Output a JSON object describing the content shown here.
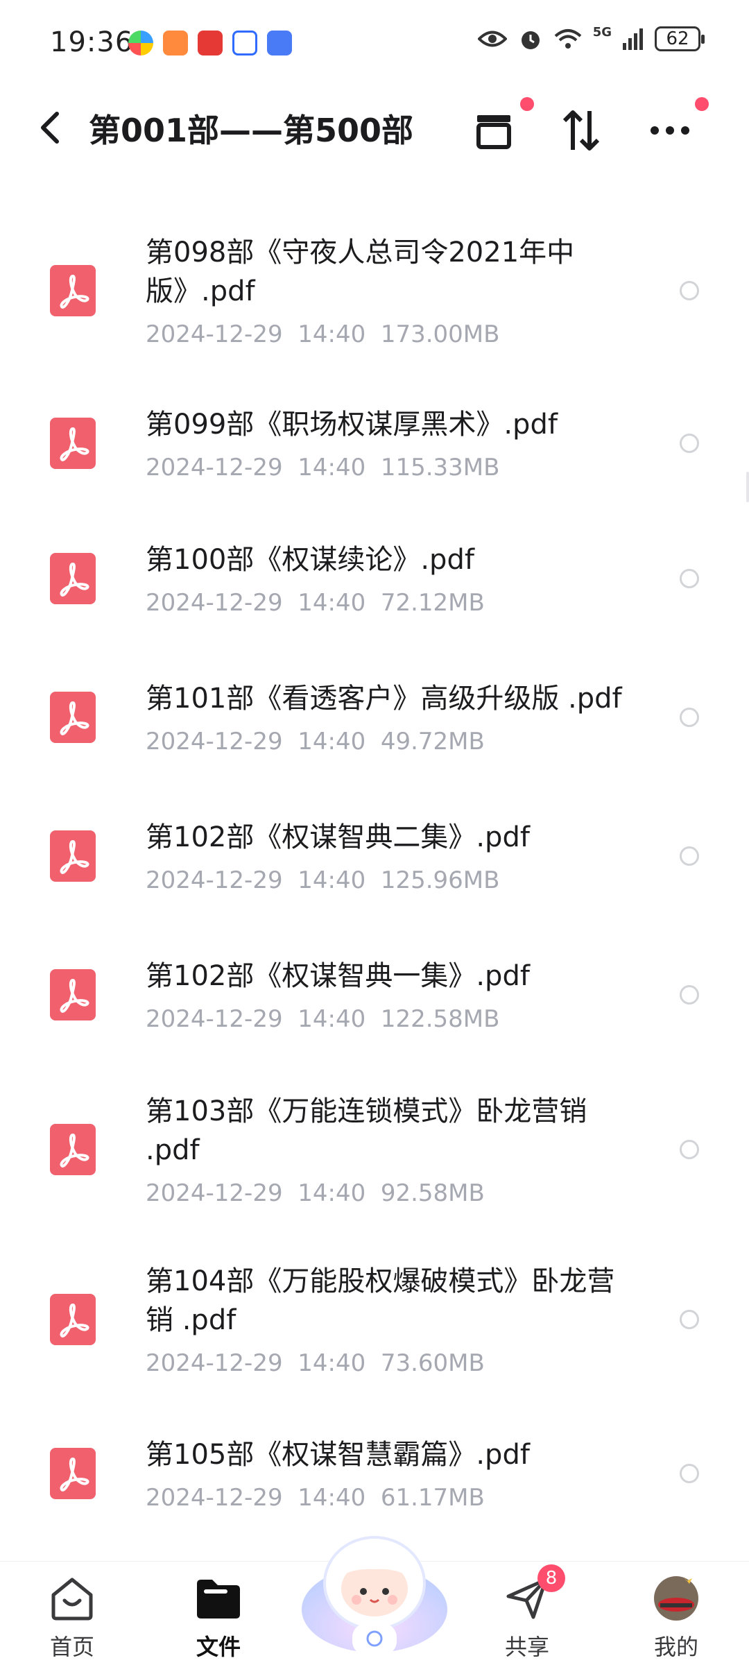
{
  "status": {
    "time": "19:36",
    "network": "5G",
    "battery": "62"
  },
  "header": {
    "title": "第001部——第500部"
  },
  "files": [
    {
      "name": "第098部《守夜人总司令2021年中版》.pdf",
      "date": "2024-12-29",
      "time": "14:40",
      "size": "173.00MB"
    },
    {
      "name": "第099部《职场权谋厚黑术》.pdf",
      "date": "2024-12-29",
      "time": "14:40",
      "size": "115.33MB"
    },
    {
      "name": "第100部《权谋续论》.pdf",
      "date": "2024-12-29",
      "time": "14:40",
      "size": "72.12MB"
    },
    {
      "name": "第101部《看透客户》高级升级版 .pdf",
      "date": "2024-12-29",
      "time": "14:40",
      "size": "49.72MB"
    },
    {
      "name": "第102部《权谋智典二集》.pdf",
      "date": "2024-12-29",
      "time": "14:40",
      "size": "125.96MB"
    },
    {
      "name": "第102部《权谋智典一集》.pdf",
      "date": "2024-12-29",
      "time": "14:40",
      "size": "122.58MB"
    },
    {
      "name": "第103部《万能连锁模式》卧龙营销 .pdf",
      "date": "2024-12-29",
      "time": "14:40",
      "size": "92.58MB"
    },
    {
      "name": "第104部《万能股权爆破模式》卧龙营销 .pdf",
      "date": "2024-12-29",
      "time": "14:40",
      "size": "73.60MB"
    },
    {
      "name": "第105部《权谋智慧霸篇》.pdf",
      "date": "2024-12-29",
      "time": "14:40",
      "size": "61.17MB"
    }
  ],
  "nav": {
    "home": "首页",
    "files": "文件",
    "share": "共享",
    "share_badge": "8",
    "mine": "我的"
  },
  "colors": {
    "accent": "#ff4d6d",
    "pdf": "#f0606d",
    "meta_text": "#a5a8b0"
  }
}
